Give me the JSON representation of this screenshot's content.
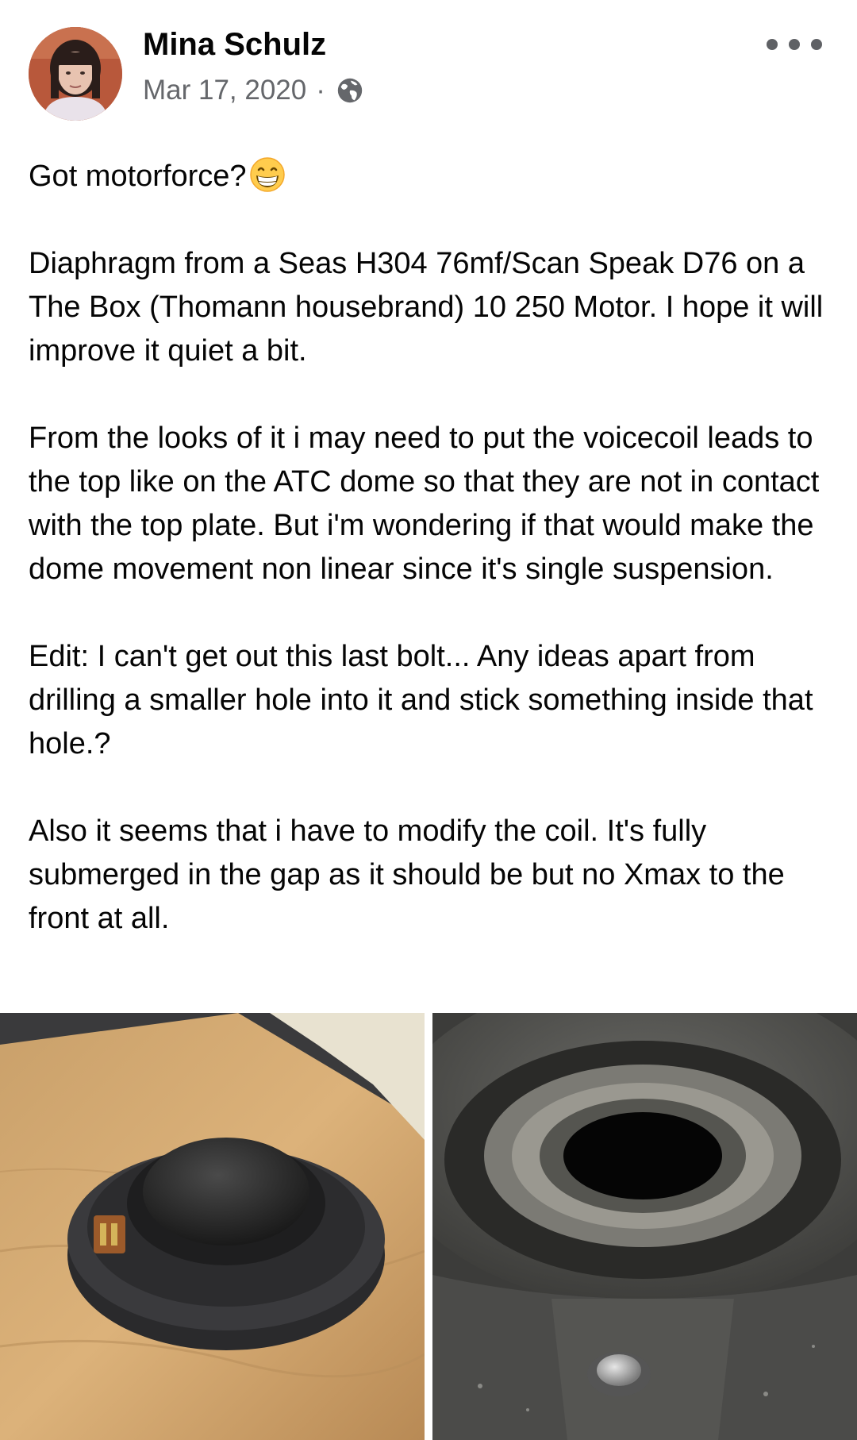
{
  "post": {
    "author_name": "Mina Schulz",
    "date": "Mar 17, 2020",
    "separator": "·",
    "privacy_icon": "globe-icon",
    "more_icon": "more-options-icon",
    "paragraphs": [
      {
        "text": "Got motorforce?",
        "emoji": "grinning-face-emoji"
      },
      {
        "text": "Diaphragm from a Seas H304 76mf/Scan Speak D76 on a The Box (Thomann housebrand) 10 250 Motor. I hope it will improve it quiet a bit."
      },
      {
        "text": "From the looks of it i may need to put the voicecoil leads to the top like on the ATC dome so that they are not in contact with the top plate. But i'm wondering if that would make the dome movement non linear since it's single suspension."
      },
      {
        "text": "Edit: I can't get out this last bolt... Any ideas apart from drilling a smaller hole into it and stick something inside that hole.?"
      },
      {
        "text": "Also it seems that i have to modify the coil. It's fully submerged in the gap as it should be but no Xmax to the front at all."
      }
    ]
  },
  "photos": [
    {
      "name": "tweeter-dome-on-wood-photo"
    },
    {
      "name": "motor-gap-with-bolt-photo"
    }
  ]
}
